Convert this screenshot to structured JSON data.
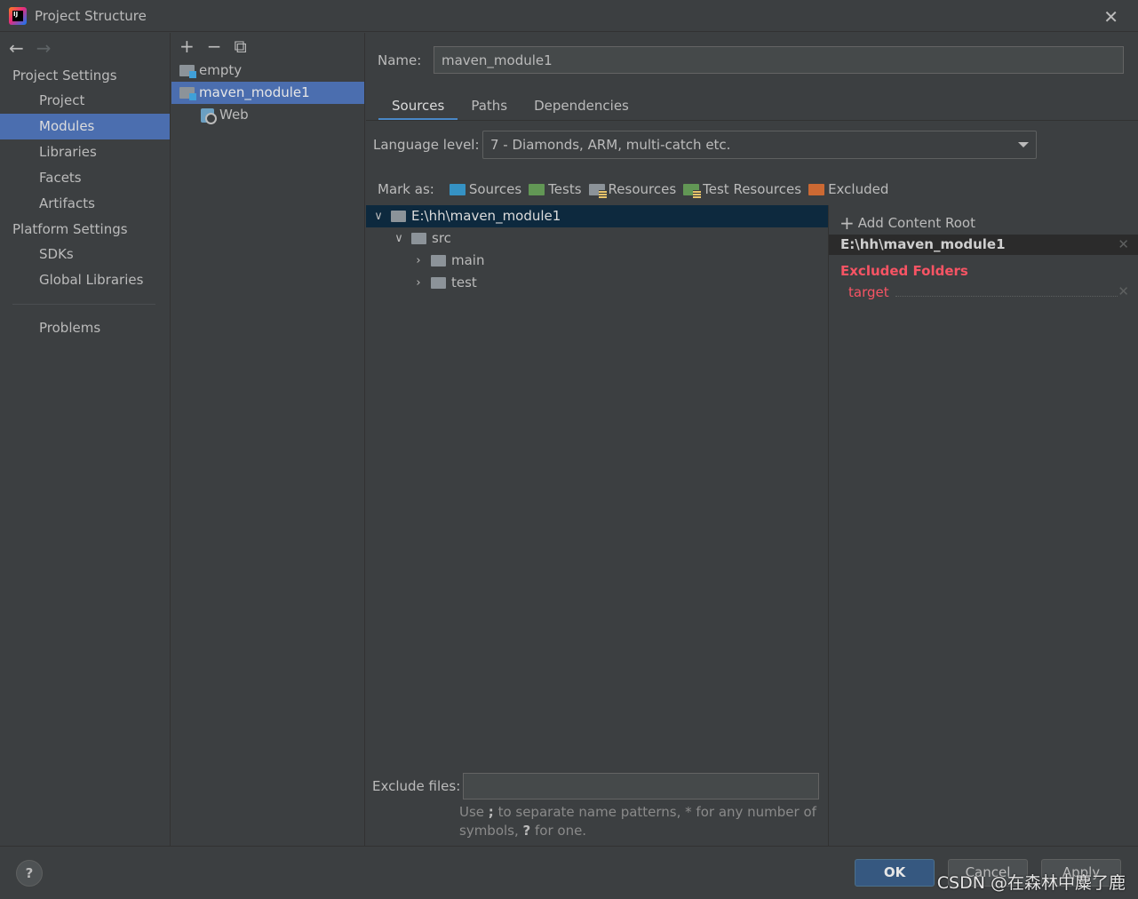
{
  "window": {
    "title": "Project Structure"
  },
  "leftnav": {
    "project_settings": "Project Settings",
    "project_items": [
      "Project",
      "Modules",
      "Libraries",
      "Facets",
      "Artifacts"
    ],
    "platform_settings": "Platform Settings",
    "platform_items": [
      "SDKs",
      "Global Libraries"
    ],
    "problems": "Problems",
    "selected": "Modules"
  },
  "modules": {
    "items": [
      {
        "label": "empty"
      },
      {
        "label": "maven_module1"
      },
      {
        "label": "Web"
      }
    ],
    "selected": "maven_module1"
  },
  "main": {
    "name_label": "Name:",
    "name_value": "maven_module1",
    "tabs": [
      "Sources",
      "Paths",
      "Dependencies"
    ],
    "active_tab": "Sources",
    "language_label": "Language level:",
    "language_value": "7 - Diamonds, ARM, multi-catch etc.",
    "mark_as_label": "Mark as:",
    "mark_as": [
      "Sources",
      "Tests",
      "Resources",
      "Test Resources",
      "Excluded"
    ],
    "tree": [
      {
        "label": "E:\\hh\\maven_module1",
        "expanded": true
      },
      {
        "label": "src",
        "expanded": true
      },
      {
        "label": "main",
        "expanded": false
      },
      {
        "label": "test",
        "expanded": false
      }
    ],
    "add_content_root": "Add Content Root",
    "content_root": "E:\\hh\\maven_module1",
    "excluded_heading": "Excluded Folders",
    "excluded_items": [
      "target"
    ],
    "exclude_files_label": "Exclude files:",
    "exclude_files_value": "",
    "hint_part1": "Use ",
    "hint_sep": ";",
    "hint_part2": " to separate name patterns, * for any number of symbols, ",
    "hint_q": "?",
    "hint_part3": " for one."
  },
  "footer": {
    "help": "?",
    "ok": "OK",
    "cancel": "Cancel",
    "apply": "Apply",
    "watermark": "CSDN @在森林中麋了鹿"
  },
  "colors": {
    "accent_selection": "#4b6eaf",
    "tree_selection": "#0d293e",
    "excluded_red": "#f75464",
    "ok_button": "#365880"
  }
}
